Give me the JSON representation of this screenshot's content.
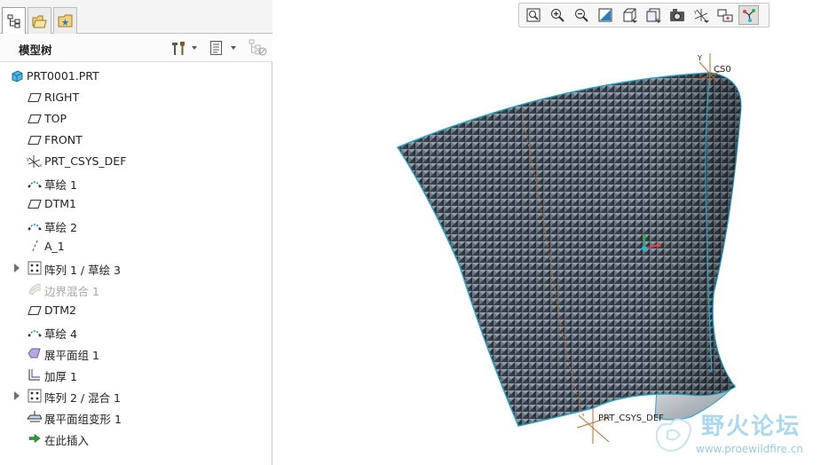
{
  "panel_tabs": [
    {
      "name": "model-tree-tab",
      "icon": "model-tree-icon",
      "active": true
    },
    {
      "name": "folder-browser-tab",
      "icon": "folder-icon",
      "active": false
    },
    {
      "name": "favorites-tab",
      "icon": "favorites-icon",
      "active": false
    }
  ],
  "tree_header": {
    "title": "模型树",
    "settings_icon": "tools-icon",
    "show_icon": "show-menu-icon",
    "filter_icon": "filter-icon"
  },
  "tree_items": [
    {
      "label": "PRT0001.PRT",
      "icon": "part-icon",
      "root": true
    },
    {
      "label": "RIGHT",
      "icon": "datum-plane-icon"
    },
    {
      "label": "TOP",
      "icon": "datum-plane-icon"
    },
    {
      "label": "FRONT",
      "icon": "datum-plane-icon"
    },
    {
      "label": "PRT_CSYS_DEF",
      "icon": "coordinate-system-icon"
    },
    {
      "label": "草绘 1",
      "icon": "sketch-icon"
    },
    {
      "label": "DTM1",
      "icon": "datum-plane-icon"
    },
    {
      "label": "草绘 2",
      "icon": "sketch-icon"
    },
    {
      "label": "A_1",
      "icon": "datum-axis-icon"
    },
    {
      "label": "阵列 1 / 草绘 3",
      "icon": "pattern-icon",
      "expandable": true
    },
    {
      "label": "边界混合 1",
      "icon": "boundary-blend-icon",
      "suppressed": true
    },
    {
      "label": "DTM2",
      "icon": "datum-plane-icon"
    },
    {
      "label": "草绘 4",
      "icon": "sketch-icon"
    },
    {
      "label": "展平面组 1",
      "icon": "flatten-quilt-icon"
    },
    {
      "label": "加厚 1",
      "icon": "thicken-icon"
    },
    {
      "label": "阵列 2 / 混合 1",
      "icon": "pattern-icon",
      "expandable": true
    },
    {
      "label": "展平面组变形 1",
      "icon": "flatten-deform-icon"
    },
    {
      "label": "在此插入",
      "icon": "insert-here-arrow-icon"
    }
  ],
  "view_toolbar": [
    {
      "name": "refit",
      "icon": "zoom-fit-icon"
    },
    {
      "name": "zoom-in",
      "icon": "zoom-in-icon"
    },
    {
      "name": "zoom-out",
      "icon": "zoom-out-icon"
    },
    {
      "name": "repaint",
      "icon": "repaint-icon"
    },
    {
      "name": "display-style",
      "icon": "display-style-icon",
      "dropdown": true
    },
    {
      "name": "saved-orientations",
      "icon": "saved-views-icon",
      "dropdown": true
    },
    {
      "name": "view-manager",
      "icon": "view-manager-icon"
    },
    {
      "name": "datum-display-filters",
      "icon": "datum-display-icon",
      "dropdown": true
    },
    {
      "name": "spin-center",
      "icon": "spin-center-icon"
    },
    {
      "name": "annotation-display",
      "icon": "annotation-display-icon",
      "active": true
    }
  ],
  "viewport": {
    "csys_top_label": "CS0",
    "csys_top_axis_label": "Y",
    "csys_bottom_label": "PRT_CSYS_DEF",
    "model_color": "#3f4a55",
    "edge_color": "#2aa6c8"
  },
  "watermark": {
    "title": "野火论坛",
    "url": "www.proewildfire.cn"
  }
}
